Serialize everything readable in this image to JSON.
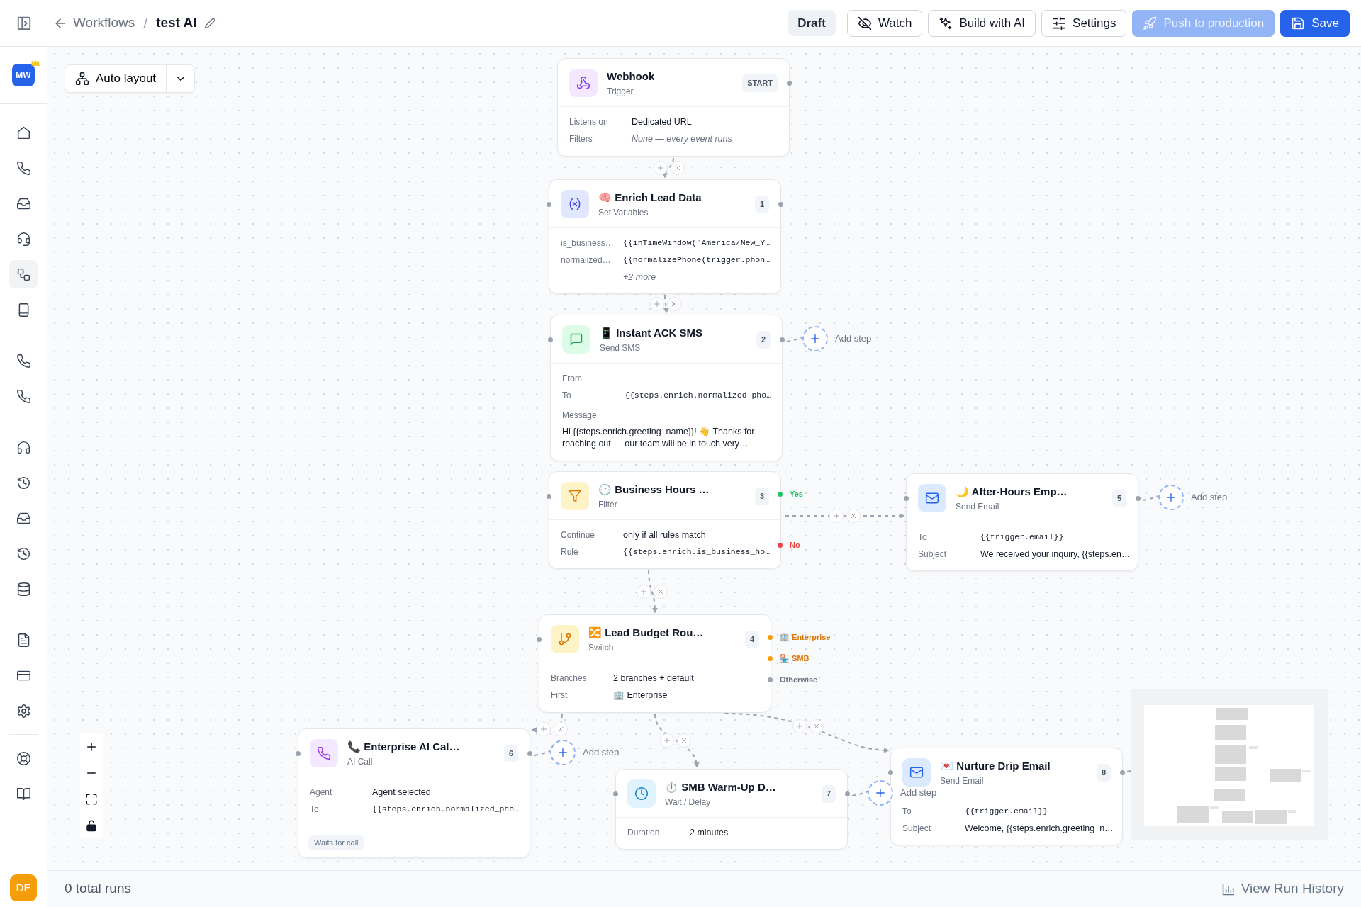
{
  "topbar": {
    "back_label": "Workflows",
    "separator": "/",
    "title": "test AI",
    "status": "Draft",
    "buttons": [
      {
        "label": "Watch",
        "kind": "outline",
        "disabled": false
      },
      {
        "label": "Build with AI",
        "kind": "outline",
        "disabled": false
      },
      {
        "label": "Settings",
        "kind": "outline",
        "disabled": false
      },
      {
        "label": "Push to production",
        "kind": "primary",
        "disabled": true
      },
      {
        "label": "Save",
        "kind": "primary",
        "disabled": false
      }
    ]
  },
  "sidebar": {
    "workspace_avatar": "MW",
    "groups": [
      {
        "items": [
          {
            "selected": false
          },
          {
            "selected": false
          },
          {
            "selected": false
          },
          {
            "selected": false
          },
          {
            "selected": true
          },
          {
            "selected": false
          }
        ]
      },
      {
        "items": [
          {
            "selected": false
          },
          {
            "selected": false
          }
        ]
      },
      {
        "items": [
          {
            "selected": false
          },
          {
            "selected": false
          },
          {
            "selected": false
          },
          {
            "selected": false
          },
          {
            "selected": false
          }
        ]
      },
      {
        "items": [
          {
            "selected": false
          },
          {
            "selected": false
          },
          {
            "selected": false
          }
        ]
      },
      {
        "items": [
          {
            "selected": false
          },
          {
            "selected": false
          }
        ]
      }
    ],
    "user_avatar": "DE"
  },
  "toolbar": {
    "auto_layout": "Auto layout"
  },
  "nodes": [
    {
      "kind": "webhook",
      "title": "Webhook",
      "subtitle": "Trigger",
      "badge": "START",
      "fields": [
        {
          "kind": "text",
          "label": "Listens on",
          "value": "Dedicated URL"
        },
        {
          "kind": "note",
          "label": "Filters",
          "value": "None — every event runs"
        }
      ]
    },
    {
      "kind": "set_variables",
      "title": "🧠 Enrich Lead Data",
      "subtitle": "Set Variables",
      "badge": "1",
      "fields": [
        {
          "kind": "code",
          "label": "is_business…",
          "value": "{{inTimeWindow(\"America/New_Y…"
        },
        {
          "kind": "code",
          "label": "normalized…",
          "value": "{{normalizePhone(trigger.phon…"
        },
        {
          "kind": "more",
          "value": "+2 more"
        }
      ]
    },
    {
      "kind": "sms",
      "title": "📱 Instant ACK SMS",
      "subtitle": "Send SMS",
      "badge": "2",
      "fields": [
        {
          "kind": "text",
          "label": "From"
        },
        {
          "kind": "code",
          "label": "To",
          "value": "{{steps.enrich.normalized_pho…"
        },
        {
          "kind": "block",
          "label": "Message",
          "value": "Hi {{steps.enrich.greeting_name}}! 👋 Thanks for reaching out — our team will be in touch very…"
        }
      ],
      "add_step": "Add step"
    },
    {
      "kind": "filter",
      "title": "🕐 Business Hours …",
      "subtitle": "Filter",
      "badge": "3",
      "fields": [
        {
          "kind": "text",
          "label": "Continue",
          "value": "only if all rules match"
        },
        {
          "kind": "code",
          "label": "Rule",
          "value": "{{steps.enrich.is_business_ho…"
        }
      ],
      "outputs": [
        {
          "label": "Yes",
          "color": "#22c55e"
        },
        {
          "label": "No",
          "color": "#ef4444"
        }
      ]
    },
    {
      "kind": "email",
      "title": "🌙 After-Hours Emp…",
      "subtitle": "Send Email",
      "badge": "5",
      "fields": [
        {
          "kind": "code",
          "label": "To",
          "value": "{{trigger.email}}"
        },
        {
          "kind": "text",
          "label": "Subject",
          "value": "We received your inquiry, {{steps.en…"
        }
      ],
      "add_step": "Add step"
    },
    {
      "kind": "switch",
      "title": "🔀 Lead Budget Rou…",
      "subtitle": "Switch",
      "badge": "4",
      "fields": [
        {
          "kind": "text",
          "label": "Branches",
          "value": "2 branches + default"
        },
        {
          "kind": "text",
          "label": "First",
          "value": "🏢 Enterprise"
        }
      ],
      "outputs": [
        {
          "label": "🏢 Enterprise",
          "color": "#f59e0b"
        },
        {
          "label": "🏪 SMB",
          "color": "#f59e0b"
        },
        {
          "label": "Otherwise",
          "color": "#9ca3af"
        }
      ]
    },
    {
      "kind": "ai_call",
      "title": "📞 Enterprise AI Cal…",
      "subtitle": "AI Call",
      "badge": "6",
      "fields": [
        {
          "kind": "text",
          "label": "Agent",
          "value": "Agent selected"
        },
        {
          "kind": "code",
          "label": "To",
          "value": "{{steps.enrich.normalized_pho…"
        }
      ],
      "footer_tag": "Waits for call",
      "add_step": "Add step"
    },
    {
      "kind": "delay",
      "title": "⏱️ SMB Warm-Up D…",
      "subtitle": "Wait / Delay",
      "badge": "7",
      "fields": [
        {
          "kind": "text",
          "label": "Duration",
          "value": "2 minutes"
        }
      ],
      "add_step": "Add step"
    },
    {
      "kind": "email",
      "title": "💌 Nurture Drip Email",
      "subtitle": "Send Email",
      "badge": "8",
      "fields": [
        {
          "kind": "code",
          "label": "To",
          "value": "{{trigger.email}}"
        },
        {
          "kind": "text",
          "label": "Subject",
          "value": "Welcome, {{steps.enrich.greeting_n…"
        }
      ]
    }
  ],
  "footer": {
    "runs": "0 total runs",
    "history": "View Run History"
  }
}
